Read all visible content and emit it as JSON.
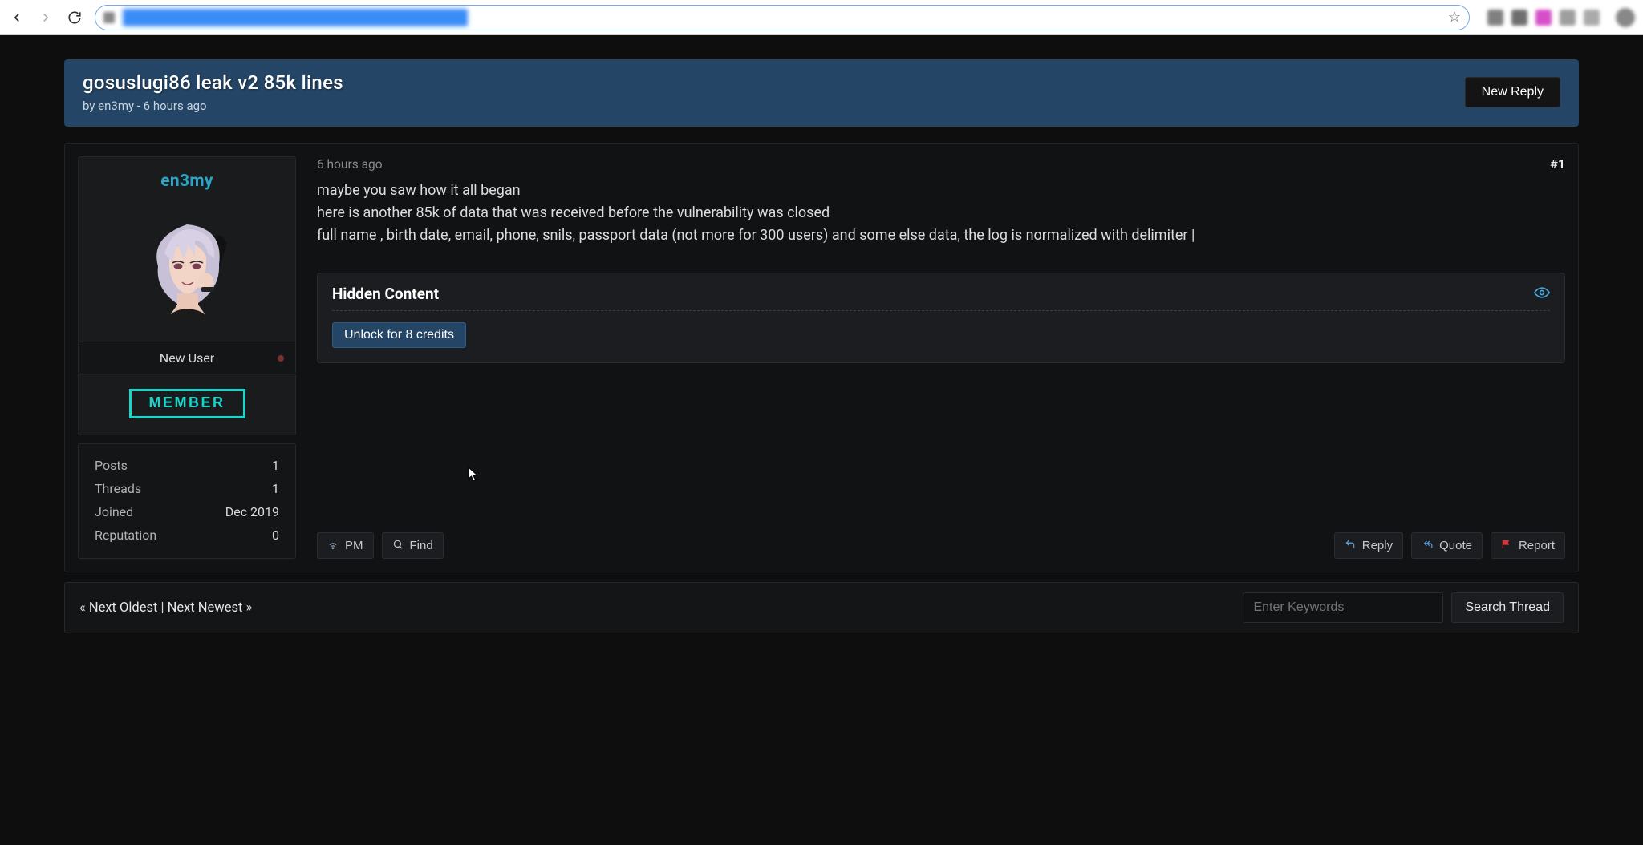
{
  "browser": {
    "back_enabled": true,
    "forward_enabled": false
  },
  "thread": {
    "title": "gosuslugi86 leak v2 85k lines",
    "byline": "by en3my - 6 hours ago",
    "new_reply_label": "New Reply"
  },
  "post": {
    "time": "6 hours ago",
    "number": "#1",
    "body_l1": "maybe you saw how it all began",
    "body_l2": "here is another 85k of data that was received before the vulnerability was closed",
    "body_l3": "full name , birth date, email, phone, snils, passport data (not more for 300 users) and some else data, the log is normalized with delimiter |"
  },
  "hidden": {
    "title": "Hidden Content",
    "unlock_label": "Unlock for 8 credits"
  },
  "user": {
    "name": "en3my",
    "role": "New User",
    "badge": "MEMBER",
    "stats": {
      "posts_label": "Posts",
      "posts_value": "1",
      "threads_label": "Threads",
      "threads_value": "1",
      "joined_label": "Joined",
      "joined_value": "Dec 2019",
      "rep_label": "Reputation",
      "rep_value": "0"
    }
  },
  "actions": {
    "pm": "PM",
    "find": "Find",
    "reply": "Reply",
    "quote": "Quote",
    "report": "Report"
  },
  "footer": {
    "prev_marker": "«",
    "oldest": "Next Oldest",
    "sep": "|",
    "newest": "Next Newest",
    "next_marker": "»",
    "search_placeholder": "Enter Keywords",
    "search_button": "Search Thread"
  }
}
